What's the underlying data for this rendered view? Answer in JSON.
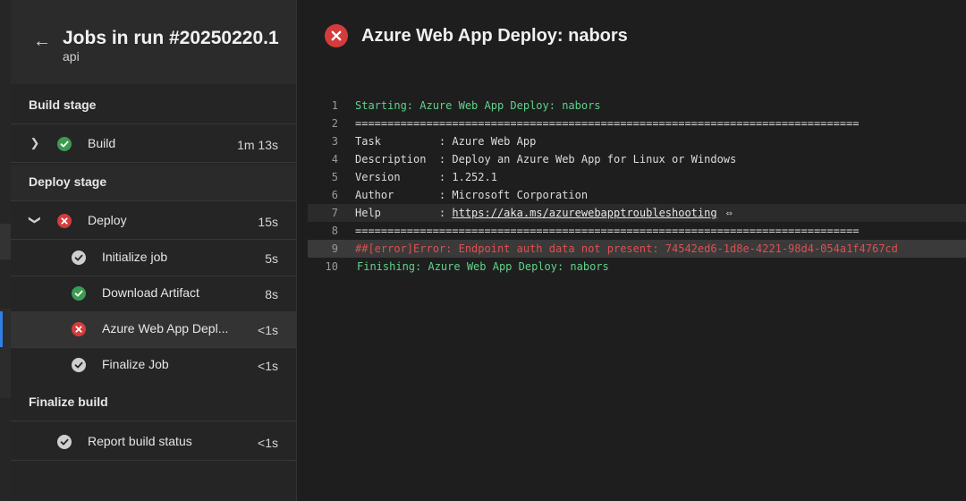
{
  "sidebar": {
    "title": "Jobs in run #20250220.1",
    "subtitle": "api",
    "back_icon": "arrow-left-icon",
    "stages": [
      {
        "label": "Build stage"
      },
      {
        "label": "Deploy stage"
      },
      {
        "label": "Finalize build"
      }
    ],
    "jobs": {
      "build": {
        "label": "Build",
        "duration": "1m 13s",
        "status": "succeeded"
      },
      "deploy": {
        "label": "Deploy",
        "duration": "15s",
        "status": "failed"
      },
      "report": {
        "label": "Report build status",
        "duration": "<1s",
        "status": "completed"
      }
    },
    "steps": [
      {
        "label": "Initialize job",
        "duration": "5s",
        "status": "completed"
      },
      {
        "label": "Download Artifact",
        "duration": "8s",
        "status": "succeeded"
      },
      {
        "label": "Azure Web App Depl...",
        "duration": "<1s",
        "status": "failed"
      },
      {
        "label": "Finalize Job",
        "duration": "<1s",
        "status": "completed"
      }
    ]
  },
  "main": {
    "title": "Azure Web App Deploy: nabors",
    "log": [
      {
        "n": "1",
        "text": "Starting: Azure Web App Deploy: nabors"
      },
      {
        "n": "2",
        "text": "=============================================================================="
      },
      {
        "n": "3",
        "text": "Task         : Azure Web App"
      },
      {
        "n": "4",
        "text": "Description  : Deploy an Azure Web App for Linux or Windows"
      },
      {
        "n": "5",
        "text": "Version      : 1.252.1"
      },
      {
        "n": "6",
        "text": "Author       : Microsoft Corporation"
      },
      {
        "n": "7",
        "text": "Help         : ",
        "link": "https://aka.ms/azurewebapptroubleshooting",
        "link_icon": "⇔"
      },
      {
        "n": "8",
        "text": "=============================================================================="
      },
      {
        "n": "9",
        "text": "##[error]Error: Endpoint auth data not present: 74542ed6-1d8e-4221-98d4-054a1f4767cd"
      },
      {
        "n": "10",
        "text": "Finishing: Azure Web App Deploy: nabors"
      }
    ]
  },
  "colors": {
    "success": "#3c9b52",
    "error": "#d43c3c",
    "log_green": "#5fd38a",
    "log_error": "#e04f4f",
    "accent": "#2f7fe6"
  }
}
